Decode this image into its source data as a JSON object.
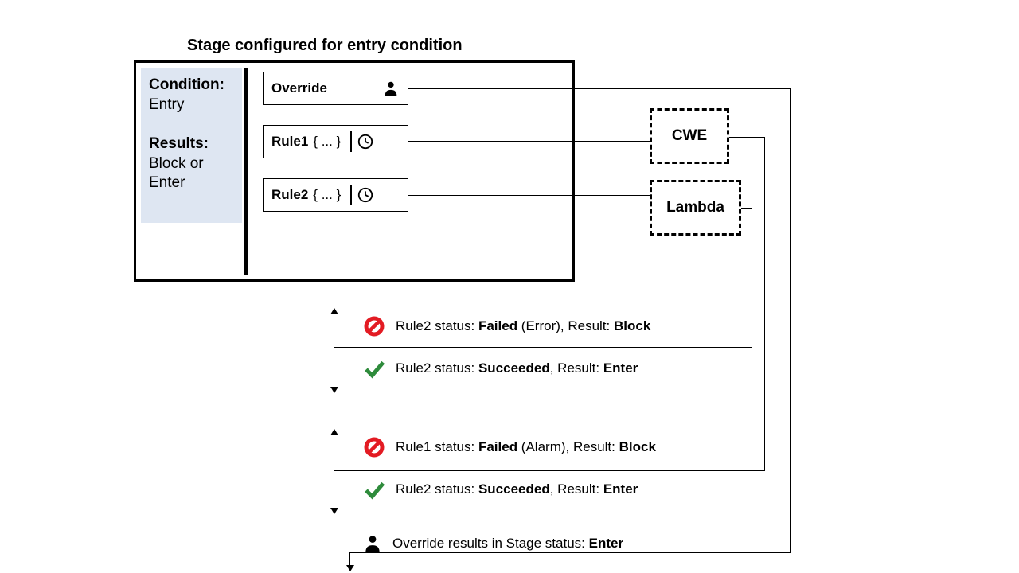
{
  "title": "Stage configured for entry condition",
  "condition": {
    "label": "Condition:",
    "value": "Entry",
    "resultsLabel": "Results:",
    "resultsValue": "Block or Enter"
  },
  "override": {
    "label": "Override"
  },
  "rule1": {
    "label": "Rule1",
    "braces": "{ ... }"
  },
  "rule2": {
    "label": "Rule2",
    "braces": "{ ... }"
  },
  "targets": {
    "cwe": "CWE",
    "lambda": "Lambda"
  },
  "statuses": {
    "s1_pre": "Rule2 status: ",
    "s1_b1": "Failed",
    "s1_mid": " (Error), Result: ",
    "s1_b2": "Block",
    "s2_pre": "Rule2 status: ",
    "s2_b1": "Succeeded",
    "s2_mid": ", Result: ",
    "s2_b2": "Enter",
    "s3_pre": "Rule1 status: ",
    "s3_b1": "Failed",
    "s3_mid": " (Alarm), Result: ",
    "s3_b2": "Block",
    "s4_pre": "Rule2 status: ",
    "s4_b1": "Succeeded",
    "s4_mid": ", Result: ",
    "s4_b2": "Enter",
    "s5_pre": "Override results in Stage status: ",
    "s5_b1": "Enter"
  }
}
